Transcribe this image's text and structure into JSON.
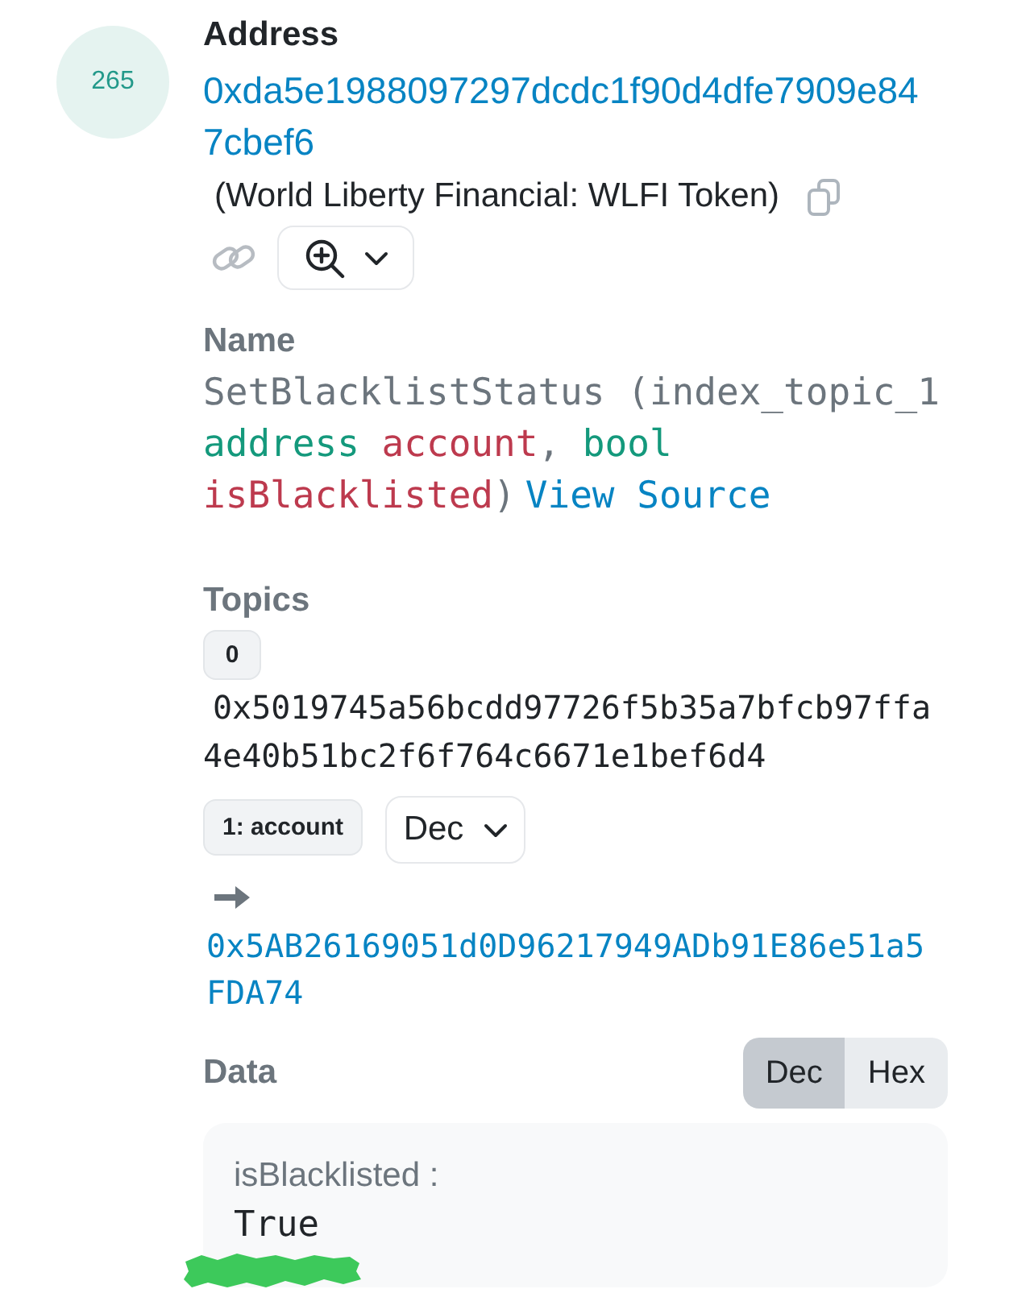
{
  "log_index": "265",
  "address": {
    "label": "Address",
    "value": "0xda5e1988097297dcdc1f90d4dfe7909e847cbef6",
    "name_tag": "(World Liberty Financial: WLFI Token)"
  },
  "name": {
    "label": "Name",
    "signature": [
      {
        "kind": "plain",
        "text": "SetBlacklistStatus (index_topic_1 "
      },
      {
        "kind": "type",
        "text": "address "
      },
      {
        "kind": "param",
        "text": "account"
      },
      {
        "kind": "plain",
        "text": ", "
      },
      {
        "kind": "type",
        "text": "bool "
      },
      {
        "kind": "param",
        "text": "isBlacklisted"
      },
      {
        "kind": "plain",
        "text": ")"
      }
    ],
    "view_source": "View Source"
  },
  "topics": {
    "label": "Topics",
    "items": [
      {
        "kind": "hash",
        "label": "0",
        "value": "0x5019745a56bcdd97726f5b35a7bfcb97ffa4e40b51bc2f6f764c6671e1bef6d4"
      },
      {
        "kind": "address",
        "label": "1: account",
        "format": "Dec",
        "value": "0x5AB26169051d0D96217949ADb91E86e51a5FDA74"
      }
    ]
  },
  "data": {
    "label": "Data",
    "formats": [
      {
        "label": "Dec",
        "selected": true
      },
      {
        "label": "Hex",
        "selected": false
      }
    ],
    "fields": [
      {
        "name": "isBlacklisted :",
        "value": "True"
      }
    ]
  }
}
